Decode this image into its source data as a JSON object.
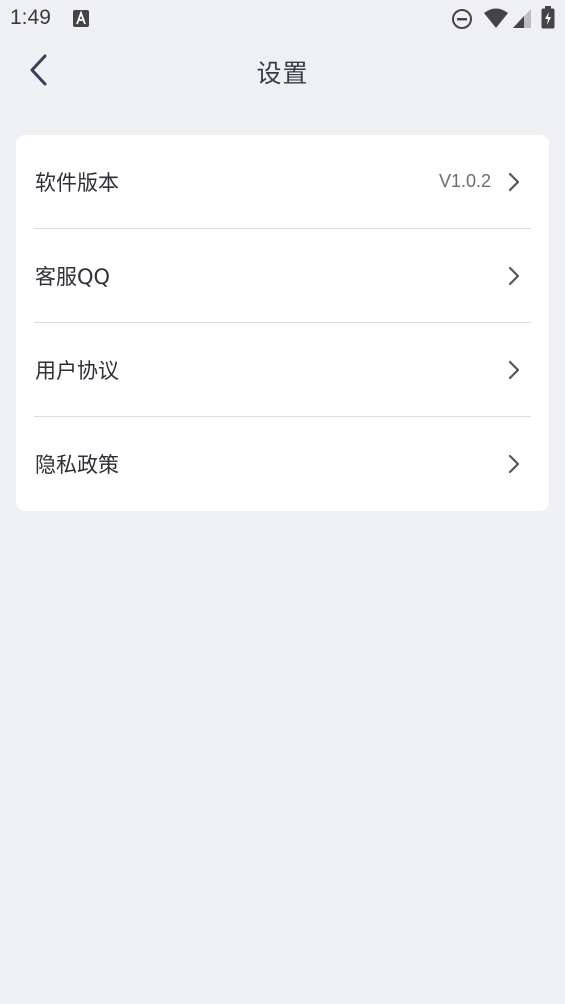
{
  "status_bar": {
    "time": "1:49",
    "icons": [
      "text-a-icon",
      "do-not-disturb-icon",
      "wifi-icon",
      "cell-signal-icon",
      "battery-charging-icon"
    ]
  },
  "header": {
    "title": "设置",
    "back_icon": "chevron-left-icon"
  },
  "settings": {
    "items": [
      {
        "label": "软件版本",
        "value": "V1.0.2"
      },
      {
        "label": "客服QQ",
        "value": ""
      },
      {
        "label": "用户协议",
        "value": ""
      },
      {
        "label": "隐私政策",
        "value": ""
      }
    ]
  },
  "colors": {
    "background": "#eff0f4",
    "card": "#ffffff",
    "divider": "#dcdce0",
    "text": "#2f2f38",
    "value_text": "#6b6b73"
  }
}
